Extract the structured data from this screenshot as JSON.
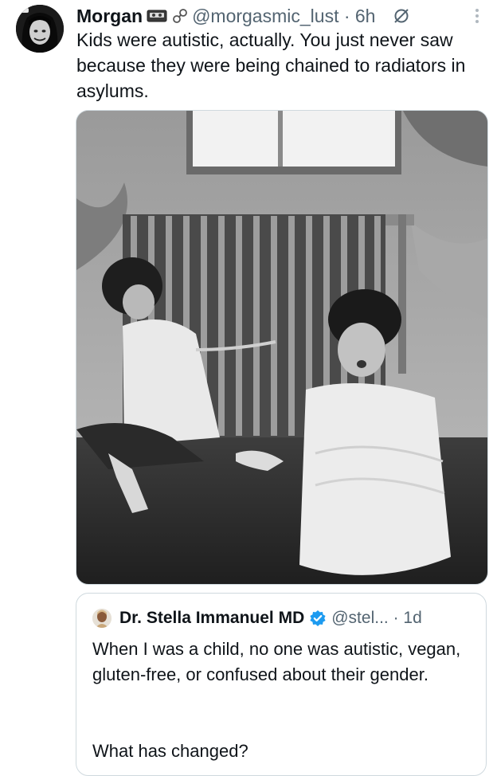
{
  "tweet": {
    "display_name": "Morgan",
    "handle_meta": "@morgasmic_lust · 6h",
    "text": "Kids were autistic, actually. You just never saw because they were being chained to radiators in asylums.",
    "icons": {
      "badge_1": "cassette-tape-icon",
      "badge_2": "link-icon",
      "grok": "grok-icon",
      "more": "more-options-icon"
    }
  },
  "quoted_tweet": {
    "display_name": "Dr. Stella Immanuel MD",
    "handle_meta": "@stel... · 1d",
    "verified_color": "#1d9bf0",
    "text_line_1": "When I was a child, no one was autistic, vegan, gluten-free, or confused about their gender.",
    "text_line_2": "What has changed?"
  },
  "colors": {
    "text_primary": "#0f1419",
    "text_secondary": "#536471",
    "border": "#cfd9de"
  }
}
